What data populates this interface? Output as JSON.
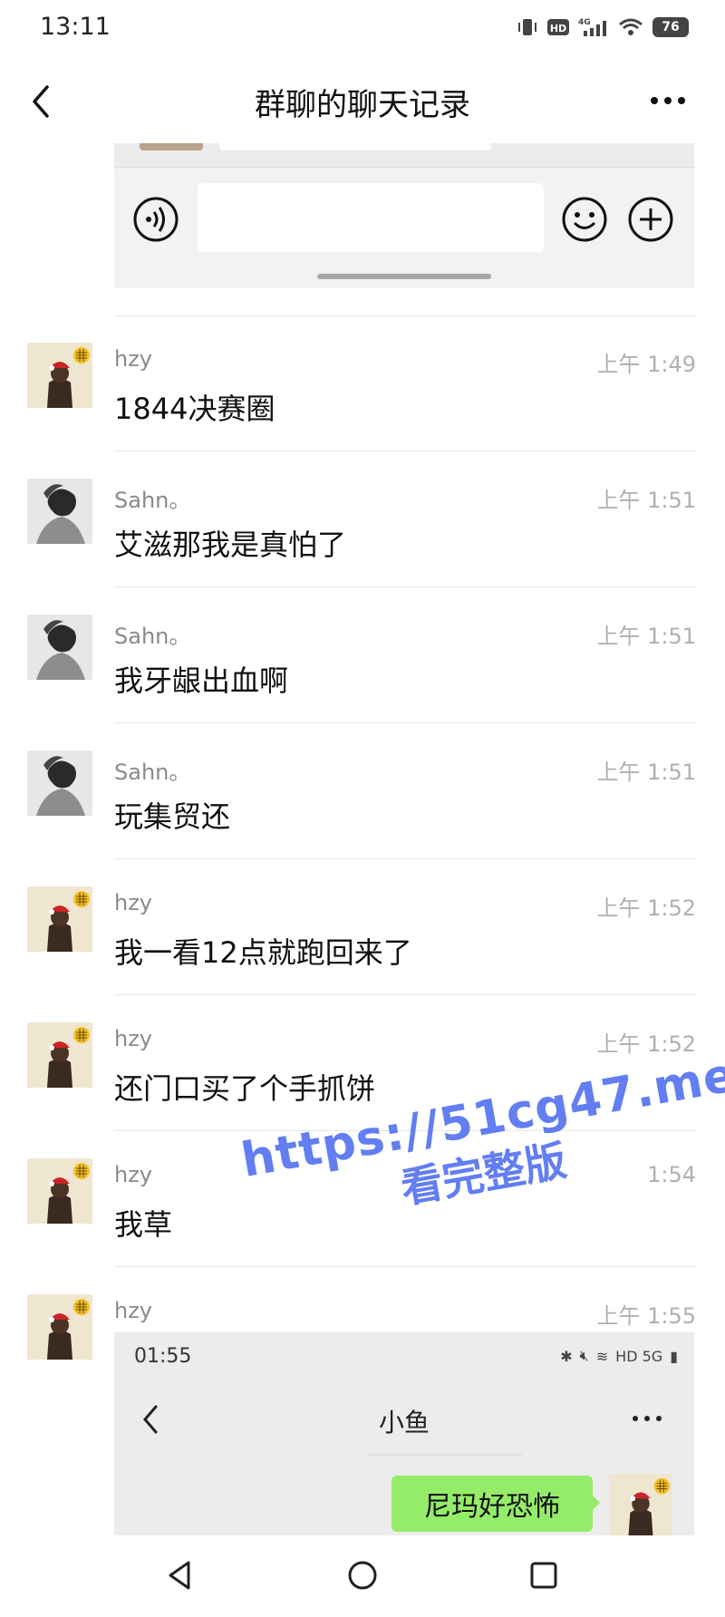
{
  "status_bar": {
    "time": "13:11",
    "network": "4G",
    "hd": "HD",
    "battery": "76"
  },
  "nav": {
    "title": "群聊的聊天记录"
  },
  "messages": [
    {
      "sender": "hzy",
      "time": "上午 1:49",
      "text": "1844决赛圈",
      "avatar": "hzy-avatar"
    },
    {
      "sender": "Sahn。",
      "time": "上午 1:51",
      "text": "艾滋那我是真怕了",
      "avatar": "sahn-avatar"
    },
    {
      "sender": "Sahn。",
      "time": "上午 1:51",
      "text": "我牙龈出血啊",
      "avatar": "sahn-avatar"
    },
    {
      "sender": "Sahn。",
      "time": "上午 1:51",
      "text": "玩集贸还",
      "avatar": "sahn-avatar"
    },
    {
      "sender": "hzy",
      "time": "上午 1:52",
      "text": "我一看12点就跑回来了",
      "avatar": "hzy-avatar"
    },
    {
      "sender": "hzy",
      "time": "上午 1:52",
      "text": "还门口买了个手抓饼",
      "avatar": "hzy-avatar"
    },
    {
      "sender": "hzy",
      "time": "1:54",
      "text": "我草",
      "avatar": "hzy-avatar"
    },
    {
      "sender": "hzy",
      "time": "上午 1:55",
      "text": "",
      "avatar": "hzy-avatar"
    }
  ],
  "screenshot": {
    "time": "01:55",
    "status": "HD 5G",
    "title": "小鱼",
    "bubble": "尼玛好恐怖"
  },
  "watermark": {
    "url": "https://51cg47.me",
    "sub": "看完整版"
  },
  "colors": {
    "bubble_green": "#95ec69",
    "watermark_blue": "#4d6df0"
  }
}
